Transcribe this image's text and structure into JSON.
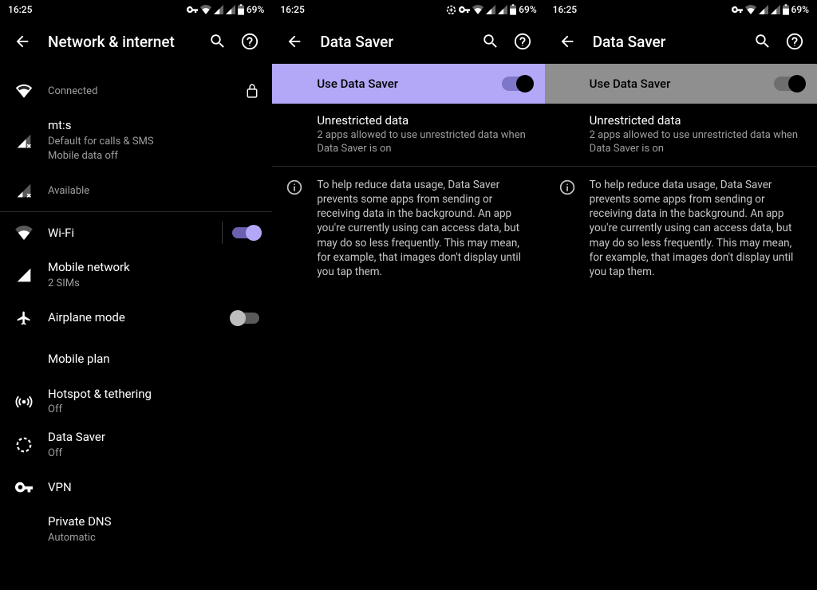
{
  "status": {
    "time": "16:25",
    "battery": "69%"
  },
  "pane1": {
    "title": "Network & internet",
    "wifi_status": "Connected",
    "carrier": {
      "name": "mt:s",
      "line1": "Default for calls & SMS",
      "line2": "Mobile data off"
    },
    "sim2": "Available",
    "wifi": "Wi-Fi",
    "mobile": {
      "title": "Mobile network",
      "sub": "2 SIMs"
    },
    "airplane": "Airplane mode",
    "plan": "Mobile plan",
    "hotspot": {
      "title": "Hotspot & tethering",
      "sub": "Off"
    },
    "datasaver": {
      "title": "Data Saver",
      "sub": "Off"
    },
    "vpn": "VPN",
    "dns": {
      "title": "Private DNS",
      "sub": "Automatic"
    }
  },
  "pane2": {
    "title": "Data Saver",
    "toggle_label": "Use Data Saver",
    "unrestricted": {
      "title": "Unrestricted data",
      "sub": "2 apps allowed to use unrestricted data when Data Saver is on"
    },
    "info": "To help reduce data usage, Data Saver prevents some apps from sending or receiving data in the background. An app you're currently using can access data, but may do so less frequently. This may mean, for example, that images don't display until you tap them."
  },
  "pane3": {
    "title": "Data Saver",
    "toggle_label": "Use Data Saver",
    "unrestricted": {
      "title": "Unrestricted data",
      "sub": "2 apps allowed to use unrestricted data when Data Saver is on"
    },
    "info": "To help reduce data usage, Data Saver prevents some apps from sending or receiving data in the background. An app you're currently using can access data, but may do so less frequently. This may mean, for example, that images don't display until you tap them."
  }
}
